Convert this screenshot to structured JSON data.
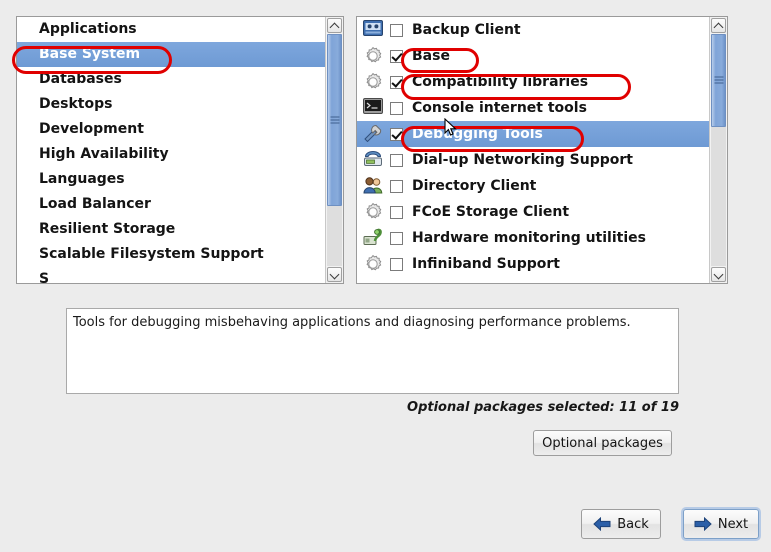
{
  "groups_panel": {
    "items": [
      {
        "label": "Applications",
        "selected": false
      },
      {
        "label": "Base System",
        "selected": true
      },
      {
        "label": "Databases",
        "selected": false
      },
      {
        "label": "Desktops",
        "selected": false
      },
      {
        "label": "Development",
        "selected": false
      },
      {
        "label": "High Availability",
        "selected": false
      },
      {
        "label": "Languages",
        "selected": false
      },
      {
        "label": "Load Balancer",
        "selected": false
      },
      {
        "label": "Resilient Storage",
        "selected": false
      },
      {
        "label": "Scalable Filesystem Support",
        "selected": false
      },
      {
        "label": "S",
        "selected": false
      }
    ],
    "scrollbar": {
      "thumb_top_pct": 0,
      "thumb_height_pct": 74
    }
  },
  "packages_panel": {
    "items": [
      {
        "label": "Backup Client",
        "checked": false,
        "selected": false,
        "icon": "backup-device-icon"
      },
      {
        "label": "Base",
        "checked": true,
        "selected": false,
        "icon": "gear-icon"
      },
      {
        "label": "Compatibility libraries",
        "checked": true,
        "selected": false,
        "icon": "gear-icon"
      },
      {
        "label": "Console internet tools",
        "checked": false,
        "selected": false,
        "icon": "terminal-icon"
      },
      {
        "label": "Debugging Tools",
        "checked": true,
        "selected": true,
        "icon": "tools-icon"
      },
      {
        "label": "Dial-up Networking Support",
        "checked": false,
        "selected": false,
        "icon": "telephone-icon"
      },
      {
        "label": "Directory Client",
        "checked": false,
        "selected": false,
        "icon": "users-icon"
      },
      {
        "label": "FCoE Storage Client",
        "checked": false,
        "selected": false,
        "icon": "gear-icon"
      },
      {
        "label": "Hardware monitoring utilities",
        "checked": false,
        "selected": false,
        "icon": "hardware-monitor-icon"
      },
      {
        "label": "Infiniband Support",
        "checked": false,
        "selected": false,
        "icon": "gear-icon"
      }
    ],
    "scrollbar": {
      "thumb_top_pct": 0,
      "thumb_height_pct": 40
    }
  },
  "description": {
    "text": "Tools for debugging misbehaving applications and diagnosing performance problems."
  },
  "status": {
    "optional_count_text": "Optional packages selected: 11 of 19"
  },
  "buttons": {
    "optional_packages": "Optional packages",
    "back": "Back",
    "next": "Next"
  },
  "colors": {
    "selection_blue": "#6e9ad4",
    "annotation_red": "#e00000",
    "window_background": "#ececec",
    "arrow_blue": "#2b5fa8"
  },
  "annotations": [
    {
      "name": "ring-base-system",
      "target": "Base System"
    },
    {
      "name": "ring-base",
      "target": "Base"
    },
    {
      "name": "ring-compat",
      "target": "Compatibility libraries"
    },
    {
      "name": "ring-debugging",
      "target": "Debugging Tools"
    }
  ]
}
